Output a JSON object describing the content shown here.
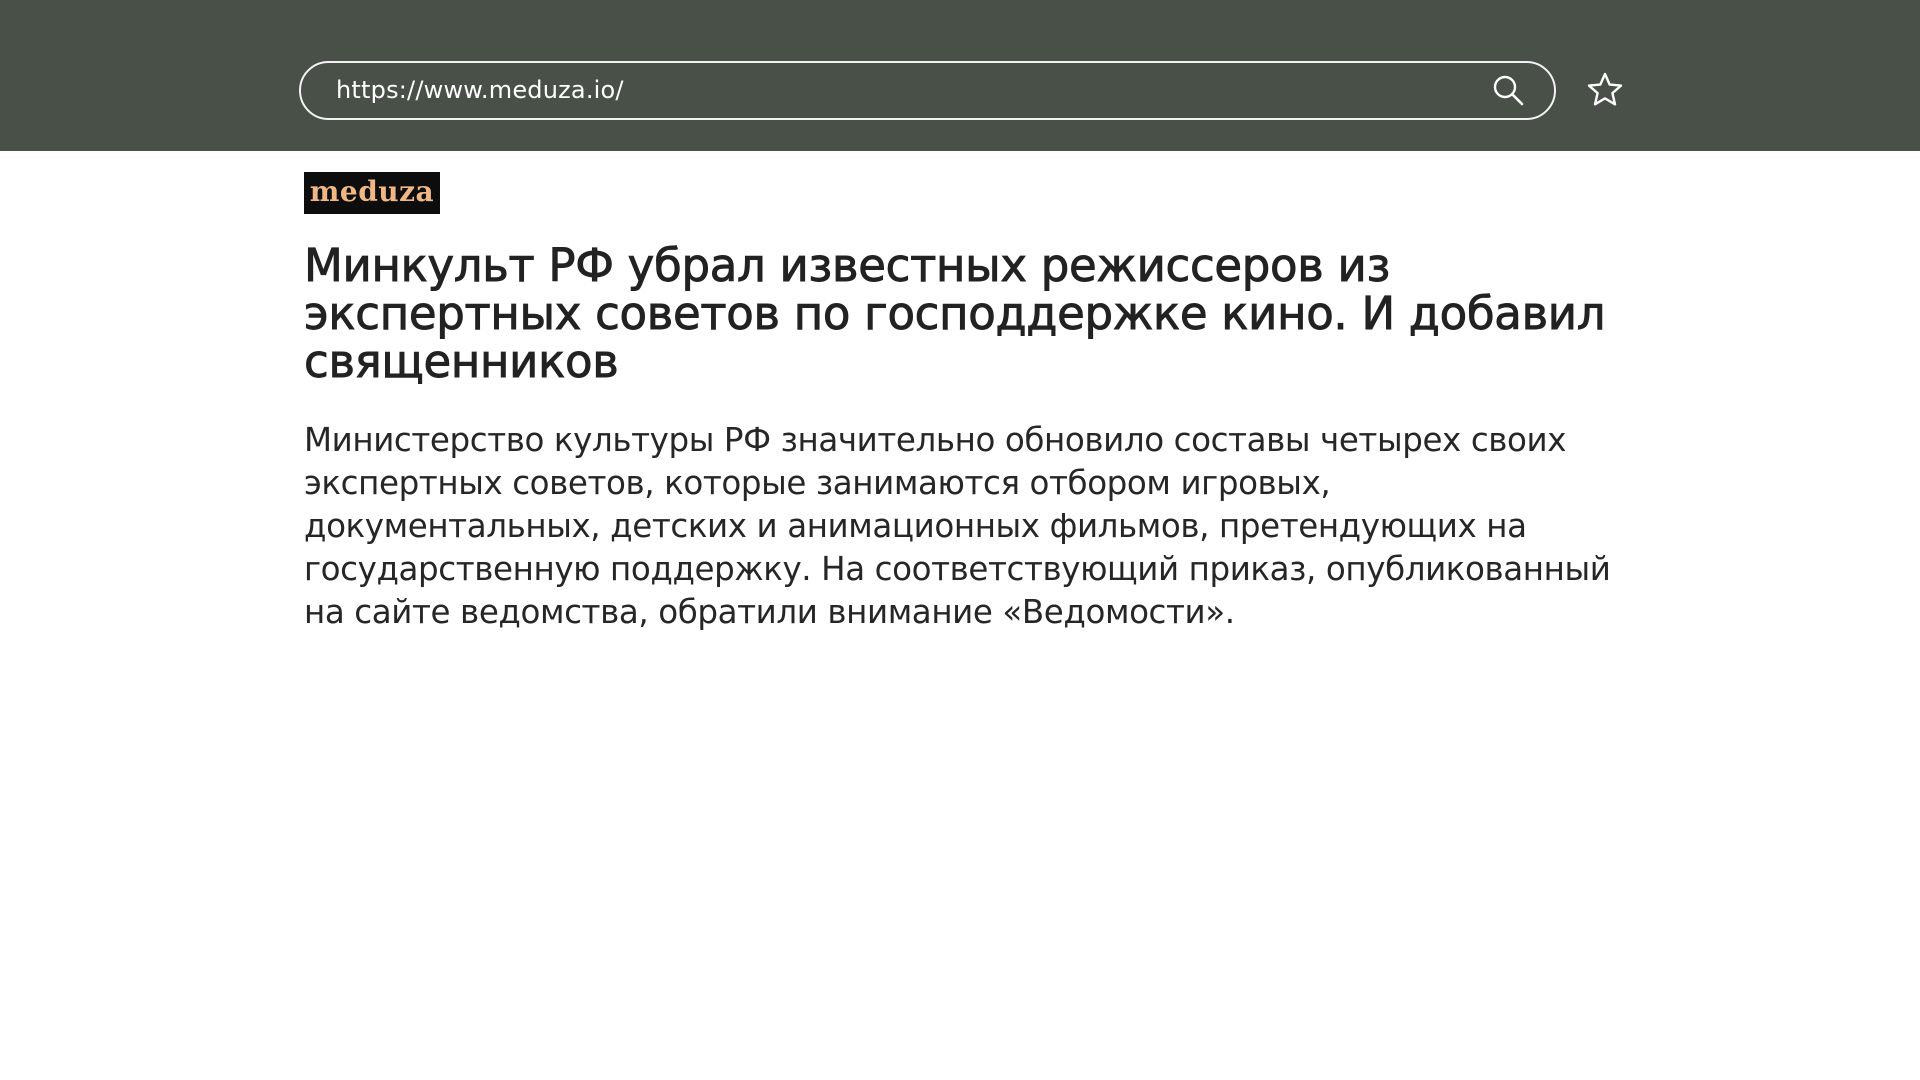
{
  "browser": {
    "url": "https://www.meduza.io/",
    "icons": {
      "search": "search-icon",
      "bookmark": "star-icon"
    },
    "colors": {
      "toolbar_background": "#495048",
      "address_border": "#f2f2f2"
    }
  },
  "article": {
    "logo_text": "meduza",
    "headline": "Минкульт РФ убрал известных режиссеров из экспертных советов по господдержке кино. И добавил священников",
    "lead": "Министерство культуры РФ значительно обновило составы четырех своих экспертных советов, которые занимаются отбором игровых, документальных, детских и анимационных фильмов, претендующих на государственную поддержку. На соответствующий приказ, опубликованный на сайте ведомства, обратили внимание «Ведомости».",
    "colors": {
      "logo_background": "#0d0d0d",
      "logo_text": "#f0b785",
      "text": "#222222"
    }
  }
}
